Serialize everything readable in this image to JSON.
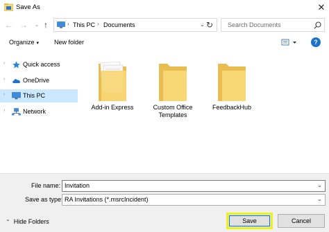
{
  "window": {
    "title": "Save As",
    "close_symbol": "✕"
  },
  "nav": {
    "back_symbol": "←",
    "forward_symbol": "→",
    "recent_symbol": "⌄",
    "up_symbol": "↑",
    "breadcrumbs": [
      "This PC",
      "Documents"
    ],
    "refresh_symbol": "↻",
    "search_placeholder": "Search Documents"
  },
  "toolbar": {
    "organize_label": "Organize",
    "new_folder_label": "New folder",
    "help_symbol": "?"
  },
  "sidebar": {
    "items": [
      {
        "label": "Quick access",
        "icon": "star-icon"
      },
      {
        "label": "OneDrive",
        "icon": "cloud-icon"
      },
      {
        "label": "This PC",
        "icon": "pc-icon",
        "selected": true
      },
      {
        "label": "Network",
        "icon": "network-icon"
      }
    ]
  },
  "folders": [
    {
      "name": "Add-in Express",
      "icon": "folder-with-documents-icon"
    },
    {
      "name": "Custom Office Templates",
      "icon": "folder-icon"
    },
    {
      "name": "FeedbackHub",
      "icon": "folder-icon"
    }
  ],
  "form": {
    "file_name_label": "File name:",
    "file_name_value": "Invitation",
    "save_type_label": "Save as type:",
    "save_type_value": "RA Invitations (*.msrcIncident)"
  },
  "footer": {
    "hide_folders_label": "Hide Folders",
    "save_label": "Save",
    "cancel_label": "Cancel"
  },
  "colors": {
    "selection": "#cce8ff",
    "highlight_outline": "#f0f01c",
    "folder_yellow": "#f8d775",
    "accent_blue": "#0078d7"
  }
}
